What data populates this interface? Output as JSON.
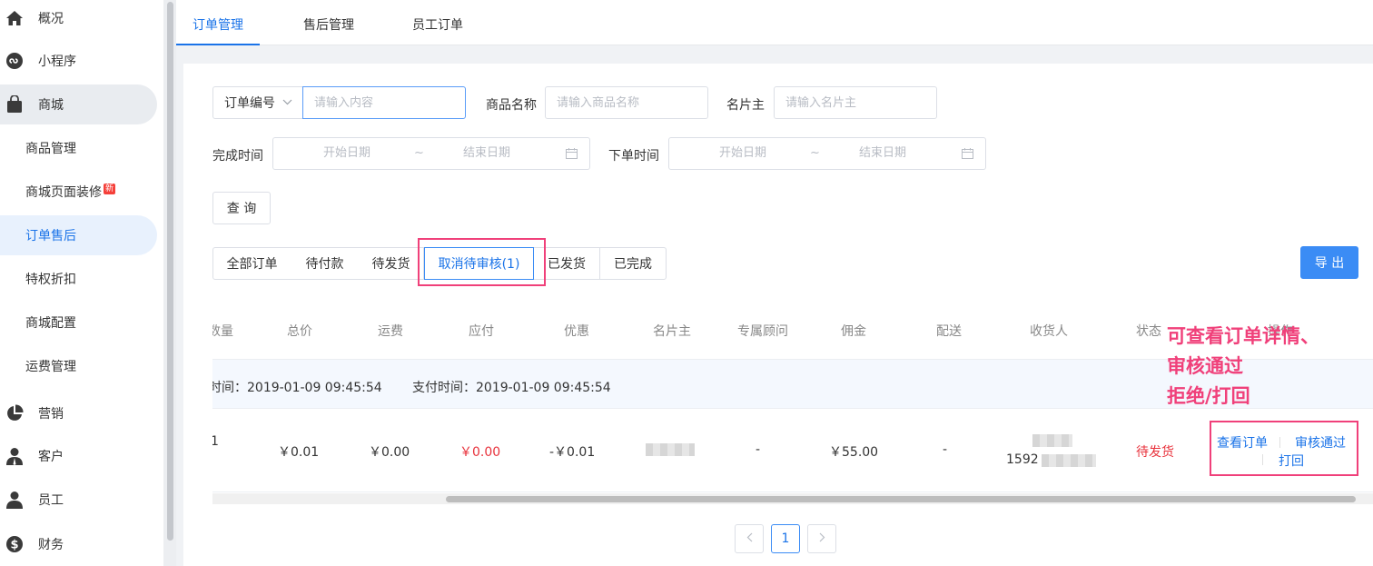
{
  "sidebar": {
    "items": [
      {
        "label": "概况",
        "icon": "home-icon"
      },
      {
        "label": "小程序",
        "icon": "miniprogram-icon"
      },
      {
        "label": "商城",
        "icon": "shopping-bag-icon"
      },
      {
        "label": "商品管理"
      },
      {
        "label": "商城页面装修",
        "badge": "新"
      },
      {
        "label": "订单售后"
      },
      {
        "label": "特权折扣"
      },
      {
        "label": "商城配置"
      },
      {
        "label": "运费管理"
      },
      {
        "label": "营销",
        "icon": "pie-chart-icon"
      },
      {
        "label": "客户",
        "icon": "customer-icon"
      },
      {
        "label": "员工",
        "icon": "staff-icon"
      },
      {
        "label": "财务",
        "icon": "dollar-icon"
      }
    ]
  },
  "tabs": [
    "订单管理",
    "售后管理",
    "员工订单"
  ],
  "filters": {
    "order_type_select": "订单编号",
    "order_input_placeholder": "请输入内容",
    "product_label": "商品名称",
    "product_placeholder": "请输入商品名称",
    "card_owner_label": "名片主",
    "card_owner_placeholder": "请输入名片主",
    "complete_time_label": "完成时间",
    "order_time_label": "下单时间",
    "start_date": "开始日期",
    "end_date": "结束日期",
    "range_sep": "~",
    "query_button": "查 询"
  },
  "status_tabs": [
    "全部订单",
    "待付款",
    "待发货",
    "取消待审核(1)",
    "已发货",
    "已完成"
  ],
  "export_button": "导 出",
  "table": {
    "headers": [
      "数量",
      "总价",
      "运费",
      "应付",
      "优惠",
      "名片主",
      "专属顾问",
      "佣金",
      "配送",
      "收货人",
      "状态",
      "操作"
    ],
    "group": {
      "order_time": "时间：2019-01-09 09:45:54",
      "pay_time": "支付时间：2019-01-09 09:45:54"
    },
    "row": {
      "qty": "1",
      "total": "￥0.01",
      "shipping": "￥0.00",
      "payable": "￥0.00",
      "discount": "-￥0.01",
      "advisor": "-",
      "commission": "￥55.00",
      "delivery": "-",
      "receiver_phone": "1592",
      "status": "待发货",
      "actions": [
        "查看订单",
        "审核通过",
        "打回"
      ]
    }
  },
  "pagination": {
    "current": "1"
  },
  "annotation": [
    "可查看订单详情、",
    "审核通过",
    "拒绝/打回"
  ],
  "colors": {
    "accent": "#1a73e8",
    "highlight": "#f0407a",
    "danger": "#e8323c"
  }
}
